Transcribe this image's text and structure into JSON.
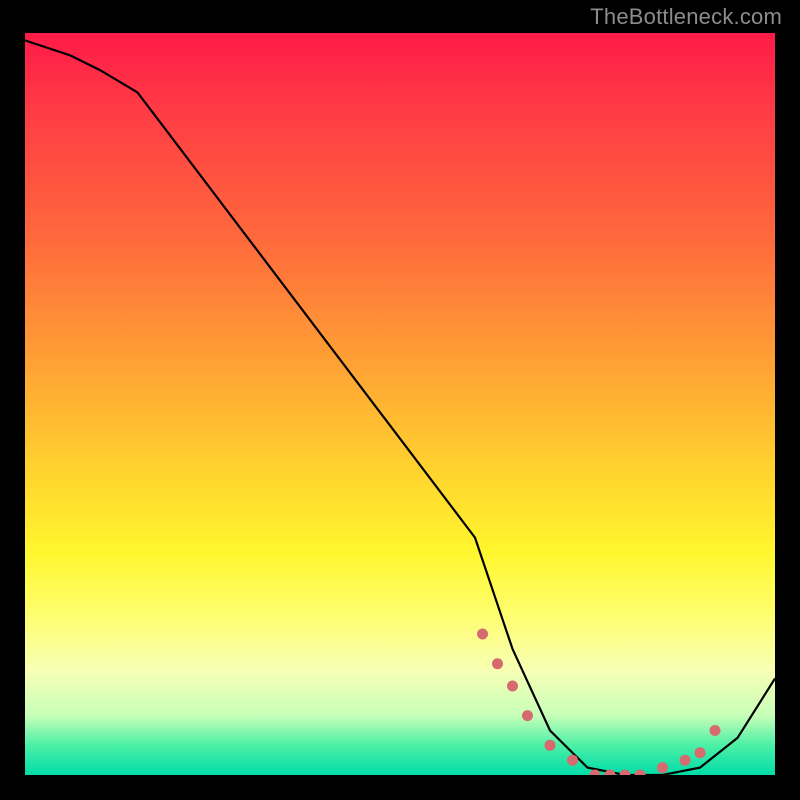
{
  "attribution": "TheBottleneck.com",
  "chart_data": {
    "type": "line",
    "title": "",
    "xlabel": "",
    "ylabel": "",
    "xlim": [
      0,
      100
    ],
    "ylim": [
      0,
      100
    ],
    "series": [
      {
        "name": "bottleneck-curve",
        "x": [
          0,
          6,
          10,
          15,
          60,
          65,
          70,
          75,
          80,
          85,
          90,
          95,
          100
        ],
        "values": [
          99,
          97,
          95,
          92,
          32,
          17,
          6,
          1,
          0,
          0,
          1,
          5,
          13
        ]
      }
    ],
    "markers": {
      "name": "highlight-dots",
      "x": [
        61,
        63,
        65,
        67,
        70,
        73,
        76,
        78,
        80,
        82,
        85,
        88,
        90,
        92
      ],
      "values": [
        19,
        15,
        12,
        8,
        4,
        2,
        0,
        0,
        0,
        0,
        1,
        2,
        3,
        6
      ]
    },
    "colors": {
      "curve": "#000000",
      "marker": "#d76a6f",
      "gradient_top": "#ff1b48",
      "gradient_mid": "#fff72e",
      "gradient_bottom": "#00dca8"
    }
  }
}
